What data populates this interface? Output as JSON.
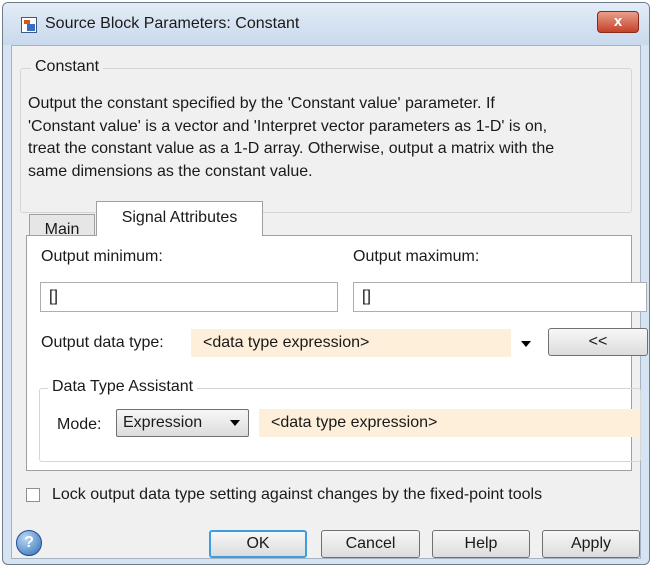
{
  "window": {
    "title": "Source Block Parameters: Constant",
    "close_glyph": "x"
  },
  "description": {
    "group_title": "Constant",
    "lines": [
      "Output the constant specified by the 'Constant value' parameter. If",
      "'Constant value' is a vector and 'Interpret vector parameters as 1-D' is on,",
      "treat the constant value as a 1-D array. Otherwise, output a matrix with the",
      "same dimensions as the constant value."
    ]
  },
  "tabs": [
    {
      "label": "Main",
      "active": false
    },
    {
      "label": "Signal Attributes",
      "active": true
    }
  ],
  "signal_attributes": {
    "output_minimum_label": "Output minimum:",
    "output_minimum_value": "[]",
    "output_maximum_label": "Output maximum:",
    "output_maximum_value": "[]",
    "output_data_type_label": "Output data type:",
    "output_data_type_value": "<data type expression>",
    "assistant_toggle_label": "<<",
    "assistant": {
      "group_title": "Data Type Assistant",
      "mode_label": "Mode:",
      "mode_value": "Expression",
      "expression_value": "<data type expression>"
    },
    "lock_checkbox_label": "Lock output data type setting against changes by the fixed-point tools",
    "lock_checked": false
  },
  "buttons": {
    "ok": "OK",
    "cancel": "Cancel",
    "help": "Help",
    "apply": "Apply"
  },
  "icons": {
    "help": "help-icon",
    "window": "simulink-block-icon",
    "close": "close-icon"
  },
  "colors": {
    "input_highlight": "#fdefd9",
    "titlebar": "#d6e3f2",
    "close": "#c7412a"
  }
}
